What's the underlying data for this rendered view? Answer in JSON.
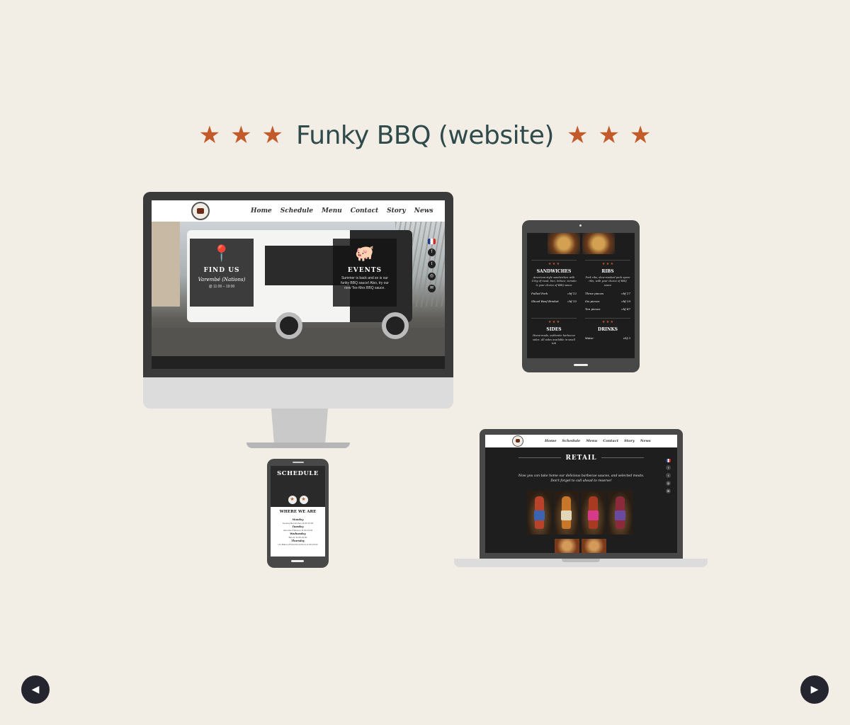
{
  "header": {
    "title": "Funky BBQ (website)",
    "star": "★"
  },
  "desktop": {
    "nav": [
      "Home",
      "Schedule",
      "Menu",
      "Contact",
      "Story",
      "News"
    ],
    "find_us": {
      "heading": "FIND US",
      "place": "Varembé (Nations)",
      "time": "@ 11:00 – 19:00"
    },
    "events": {
      "heading": "EVENTS",
      "text": "Summer is back and so is our funky BBQ sauce! Also, try our new Tex-Mex BBQ sauce."
    },
    "social": [
      "f",
      "t",
      "◎",
      "✉"
    ]
  },
  "tablet": {
    "sections": [
      {
        "stars": "★ ★ ★",
        "heading": "SANDWICHES",
        "desc": "American-style sandwiches with 150g of meat, bun, lettuce, tomato & your choice of BBQ sauce",
        "rows": [
          [
            "Pulled Pork",
            "chf 12"
          ],
          [
            "Sliced Beef Brisket",
            "chf 15"
          ]
        ]
      },
      {
        "stars": "★ ★ ★",
        "heading": "RIBS",
        "desc": "Pork ribs, slow-smoked pork spare ribs, with your choice of BBQ sauce",
        "rows": [
          [
            "Three pieces",
            "chf 17"
          ],
          [
            "Six pieces",
            "chf 29"
          ],
          [
            "Ten pieces",
            "chf 47"
          ]
        ]
      },
      {
        "stars": "★ ★ ★",
        "heading": "SIDES",
        "desc": "Home-made, authentic barbecue sides. All sides available in small tub",
        "rows": []
      },
      {
        "stars": "★ ★ ★",
        "heading": "DRINKS",
        "desc": "",
        "rows": [
          [
            "Water",
            "chf 3"
          ]
        ]
      }
    ]
  },
  "phone": {
    "schedule": "SCHEDULE",
    "where": "WHERE WE ARE",
    "days": [
      {
        "day": "Monday",
        "loc": "Genève-Bel-Anches 11:00-15:00"
      },
      {
        "day": "Tuesday",
        "loc": "Varembé (Nations) 11:00-19:00"
      },
      {
        "day": "Wednesday",
        "loc": "Bel-Air 11:00-15:00"
      },
      {
        "day": "Thursday",
        "loc": "Uni Bahes (Plaza Rond-Pont) 11:00-15:00"
      }
    ]
  },
  "laptop": {
    "nav": [
      "Home",
      "Schedule",
      "Menu",
      "Contact",
      "Story",
      "News"
    ],
    "retail": "RETAIL",
    "sub1": "Now you can take home our delicious barbecue sauces, and selected meats.",
    "sub2": "Don't forget to call ahead to reserve!",
    "bottle_colors": [
      "#b8432a",
      "#c7762a",
      "#a83a22",
      "#8a2a3a"
    ],
    "label_colors": [
      "#3a64b0",
      "#e2d6b8",
      "#d83a8a",
      "#6a4aa0"
    ]
  },
  "colors": {
    "accent": "#c25a2a",
    "title": "#2f4a4a",
    "background": "#f2eee6"
  }
}
